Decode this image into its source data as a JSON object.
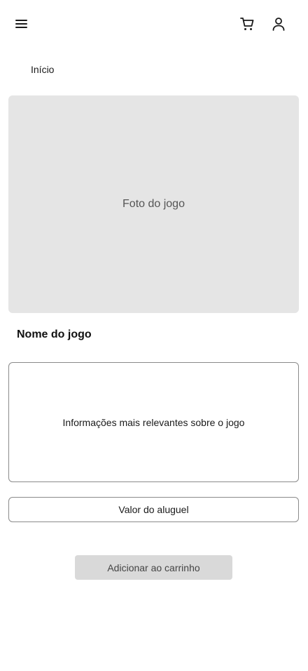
{
  "header": {
    "menu_icon": "hamburger-menu-icon",
    "cart_icon": "shopping-cart-icon",
    "user_icon": "user-profile-icon"
  },
  "breadcrumb": {
    "home_label": "Início"
  },
  "product": {
    "photo_label": "Foto do jogo",
    "name": "Nome do jogo",
    "info_text": "Informações mais relevantes sobre o jogo",
    "price_label": "Valor do aluguel",
    "add_to_cart_label": "Adicionar ao carrinho"
  },
  "colors": {
    "photo_placeholder": "#e5e5e5",
    "button_bg": "#d9d9d9",
    "border": "#8a8a8a"
  }
}
